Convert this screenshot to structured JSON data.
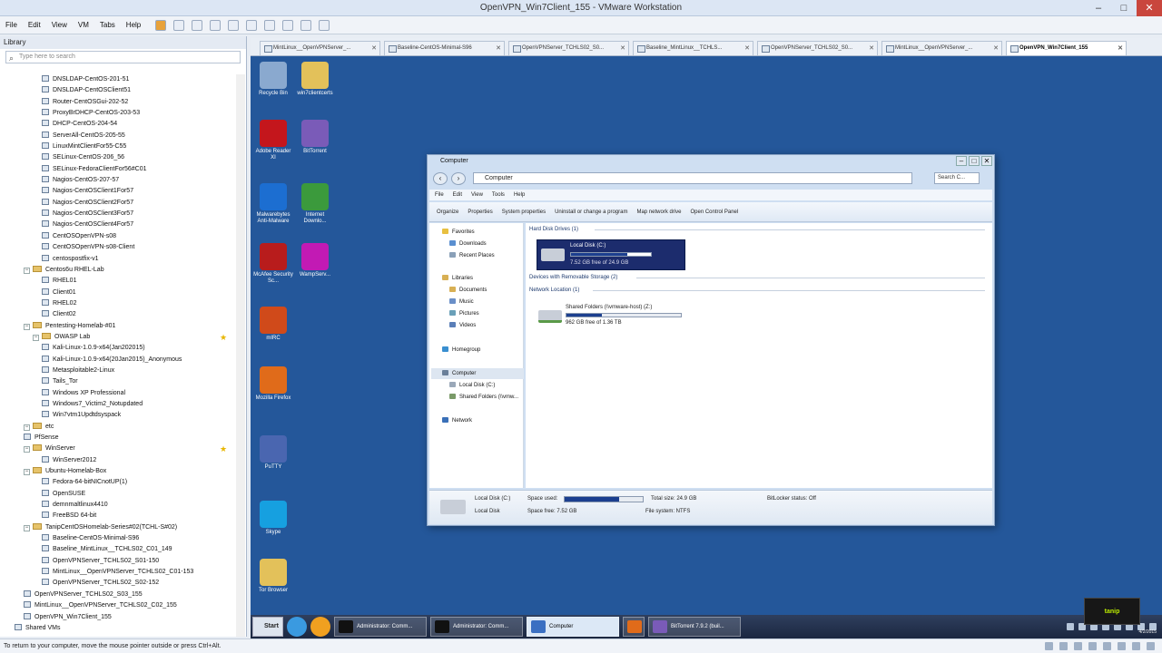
{
  "window": {
    "title": "OpenVPN_Win7Client_155 - VMware Workstation",
    "minimize": "–",
    "maximize": "□",
    "close": "✕"
  },
  "menu": [
    "File",
    "Edit",
    "View",
    "VM",
    "Tabs",
    "Help"
  ],
  "library": {
    "header": "Library",
    "search_placeholder": "Type here to search",
    "items": [
      {
        "label": "DNSLDAP-CentOS-201-51",
        "level": 4,
        "kind": "vm"
      },
      {
        "label": "DNSLDAP-CentOSClient51",
        "level": 4,
        "kind": "vm"
      },
      {
        "label": "Router-CentOSGui-202-52",
        "level": 4,
        "kind": "vm"
      },
      {
        "label": "ProxyBrDHCP-CentOS-203-53",
        "level": 4,
        "kind": "vm"
      },
      {
        "label": "DHCP-CentOS-204-54",
        "level": 4,
        "kind": "vm"
      },
      {
        "label": "ServerAll-CentOS-205-55",
        "level": 4,
        "kind": "vm"
      },
      {
        "label": "LinuxMintClientFor55-C55",
        "level": 4,
        "kind": "vm"
      },
      {
        "label": "SELinux-CentOS-206_56",
        "level": 4,
        "kind": "vm"
      },
      {
        "label": "SELinux-FedoraClientFor56#C01",
        "level": 4,
        "kind": "vm"
      },
      {
        "label": "Nagios-CentOS-207-57",
        "level": 4,
        "kind": "vm"
      },
      {
        "label": "Nagios-CentOSClient1For57",
        "level": 4,
        "kind": "vm"
      },
      {
        "label": "Nagios-CentOSClient2For57",
        "level": 4,
        "kind": "vm"
      },
      {
        "label": "Nagios-CentOSClient3For57",
        "level": 4,
        "kind": "vm"
      },
      {
        "label": "Nagios-CentOSClient4For57",
        "level": 4,
        "kind": "vm"
      },
      {
        "label": "CentOSOpenVPN-s08",
        "level": 4,
        "kind": "vm"
      },
      {
        "label": "CentOSOpenVPN-s08-Client",
        "level": 4,
        "kind": "vm"
      },
      {
        "label": "centospostfix-v1",
        "level": 4,
        "kind": "vm"
      },
      {
        "label": "Centos6u RHEL-Lab",
        "level": 2,
        "kind": "folder"
      },
      {
        "label": "RHEL01",
        "level": 4,
        "kind": "vm"
      },
      {
        "label": "Client01",
        "level": 4,
        "kind": "vm"
      },
      {
        "label": "RHEL02",
        "level": 4,
        "kind": "vm"
      },
      {
        "label": "Client02",
        "level": 4,
        "kind": "vm"
      },
      {
        "label": "Pentesting-Homelab-#01",
        "level": 2,
        "kind": "folder"
      },
      {
        "label": "OWASP Lab",
        "level": 3,
        "kind": "folder",
        "star": true
      },
      {
        "label": "Kali-Linux-1.0.9-x64(Jan202015)",
        "level": 4,
        "kind": "vm"
      },
      {
        "label": "Kali-Linux-1.0.9-x64(20Jan2015)_Anonymous",
        "level": 4,
        "kind": "vm"
      },
      {
        "label": "Metasploitable2-Linux",
        "level": 4,
        "kind": "vm"
      },
      {
        "label": "Tails_Tor",
        "level": 4,
        "kind": "vm"
      },
      {
        "label": "Windows XP Professional",
        "level": 4,
        "kind": "vm"
      },
      {
        "label": "Windows7_Victim2_Notupdated",
        "level": 4,
        "kind": "vm"
      },
      {
        "label": "Win7vtm1Updtdsyspack",
        "level": 4,
        "kind": "vm"
      },
      {
        "label": "etc",
        "level": 2,
        "kind": "folder"
      },
      {
        "label": "PfSense",
        "level": 2,
        "kind": "vm"
      },
      {
        "label": "WinServer",
        "level": 2,
        "kind": "folder",
        "star": true
      },
      {
        "label": "WinServer2012",
        "level": 4,
        "kind": "vm"
      },
      {
        "label": "Ubuntu-Homelab-Box",
        "level": 2,
        "kind": "folder"
      },
      {
        "label": "Fedora-64-bitNICnotUP(1)",
        "level": 4,
        "kind": "vm"
      },
      {
        "label": "OpenSUSE",
        "level": 4,
        "kind": "vm"
      },
      {
        "label": "demnmaltlinux4410",
        "level": 4,
        "kind": "vm"
      },
      {
        "label": "FreeBSD 64-bit",
        "level": 4,
        "kind": "vm"
      },
      {
        "label": "TanipCentOSHomelab-Series#02(TCHL-S#02)",
        "level": 2,
        "kind": "folder"
      },
      {
        "label": "Baseline-CentOS-Minimal-S96",
        "level": 4,
        "kind": "vm"
      },
      {
        "label": "Baseline_MintLinux__TCHLS02_C01_149",
        "level": 4,
        "kind": "vm"
      },
      {
        "label": "OpenVPNServer_TCHLS02_S01-150",
        "level": 4,
        "kind": "vm"
      },
      {
        "label": "MintLinux__OpenVPNServer_TCHLS02_C01-153",
        "level": 4,
        "kind": "vm"
      },
      {
        "label": "OpenVPNServer_TCHLS02_S02-152",
        "level": 4,
        "kind": "vm"
      },
      {
        "label": "OpenVPNServer_TCHLS02_S03_155",
        "level": 2,
        "kind": "vm"
      },
      {
        "label": "MintLinux__OpenVPNServer_TCHLS02_C02_155",
        "level": 2,
        "kind": "vm"
      },
      {
        "label": "OpenVPN_Win7Client_155",
        "level": 2,
        "kind": "vm"
      },
      {
        "label": "Shared VMs",
        "level": 1,
        "kind": "vm"
      }
    ]
  },
  "tabs": [
    {
      "label": "MintLinux__OpenVPNServer_...",
      "active": false
    },
    {
      "label": "Baseline-CentOS-Minimal-S96",
      "active": false
    },
    {
      "label": "OpenVPNServer_TCHLS02_S0...",
      "active": false
    },
    {
      "label": "Baseline_MintLinux__TCHLS...",
      "active": false
    },
    {
      "label": "OpenVPNServer_TCHLS02_S0...",
      "active": false
    },
    {
      "label": "MintLinux__OpenVPNServer_...",
      "active": false
    },
    {
      "label": "OpenVPN_Win7Client_155",
      "active": true
    }
  ],
  "desktop_icons": [
    {
      "label": "Recycle Bin",
      "color": "#8aa9cf"
    },
    {
      "label": "win7clientcerts",
      "color": "#e3c15a"
    },
    {
      "label": "Adobe Reader XI",
      "color": "#c4161c"
    },
    {
      "label": "BitTorrent",
      "color": "#7a5bb8"
    },
    {
      "label": "Malwarebytes Anti-Malware",
      "color": "#1c6ed1"
    },
    {
      "label": "Internet Downlo...",
      "color": "#3b9a3c"
    },
    {
      "label": "McAfee Security Sc...",
      "color": "#b81c1c"
    },
    {
      "label": "WampServ...",
      "color": "#c21ab4"
    },
    {
      "label": "mIRC",
      "color": "#d04a1a"
    },
    {
      "label": "Mozilla Firefox",
      "color": "#e06b1a"
    },
    {
      "label": "PuTTY",
      "color": "#4a66b0"
    },
    {
      "label": "Skype",
      "color": "#16a0e0"
    },
    {
      "label": "Tor Browser",
      "color": "#e3c15a"
    }
  ],
  "explorer": {
    "title": "Computer",
    "address": "Computer",
    "search_placeholder": "Search C...",
    "menu": [
      "File",
      "Edit",
      "View",
      "Tools",
      "Help"
    ],
    "commands": [
      "Organize",
      "Properties",
      "System properties",
      "Uninstall or change a program",
      "Map network drive",
      "Open Control Panel"
    ],
    "nav": {
      "favorites": "Favorites",
      "downloads": "Downloads",
      "recent": "Recent Places",
      "libraries": "Libraries",
      "documents": "Documents",
      "music": "Music",
      "pictures": "Pictures",
      "videos": "Videos",
      "homegroup": "Homegroup",
      "computer": "Computer",
      "local_disk": "Local Disk (C:)",
      "shared": "Shared Folders (\\\\vmw...",
      "network": "Network"
    },
    "groups": {
      "hdd": "Hard Disk Drives (1)",
      "removable": "Devices with Removable Storage (2)",
      "network": "Network Location (1)"
    },
    "drive_c": {
      "name": "Local Disk (C:)",
      "free": "7.52 GB free of 24.9 GB",
      "used_fraction": 0.7
    },
    "shared": {
      "name": "Shared Folders (\\\\vmware-host) (Z:)",
      "free": "962 GB free of 1.36 TB",
      "used_fraction": 0.31
    },
    "details": {
      "name": "Local Disk (C:)",
      "space_used_label": "Space used:",
      "type": "Local Disk",
      "space_free": "Space free: 7.52 GB",
      "total_size": "Total size: 24.9 GB",
      "file_system": "File system: NTFS",
      "bitlocker": "BitLocker status: Off",
      "used_fraction": 0.7
    }
  },
  "taskbar": {
    "start": "Start",
    "buttons": [
      {
        "label": "Administrator: Comm...",
        "color": "#111",
        "active": false
      },
      {
        "label": "Administrator: Comm...",
        "color": "#111",
        "active": false
      },
      {
        "label": "Computer",
        "color": "#3a6fc2",
        "active": true
      },
      {
        "label": "",
        "color": "#e06b1a",
        "active": false
      },
      {
        "label": "BitTorrent 7.9.2 (buil...",
        "color": "#7a5bb8",
        "active": false
      }
    ],
    "clock": "4/2/2015"
  },
  "logo_text": "tanip",
  "status": "To return to your computer, move the mouse pointer outside or press Ctrl+Alt."
}
